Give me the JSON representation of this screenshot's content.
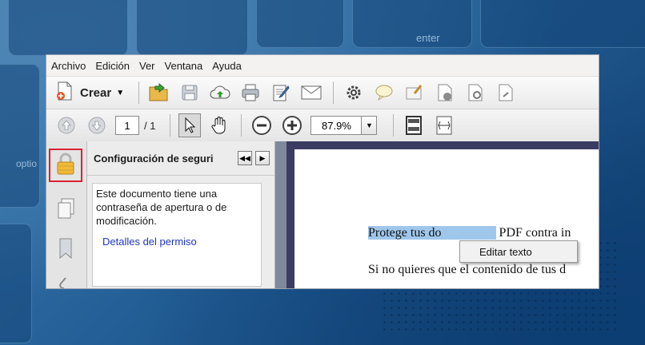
{
  "background": {
    "enter_key": "enter",
    "option_key": "optio"
  },
  "menu": [
    "Archivo",
    "Edición",
    "Ver",
    "Ventana",
    "Ayuda"
  ],
  "toolbar": {
    "crear_label": "Crear",
    "icons": [
      "open-folder-icon",
      "save-icon",
      "cloud-upload-icon",
      "print-icon",
      "edit-document-icon",
      "email-icon",
      "settings-gear-icon",
      "comment-icon",
      "sign-icon",
      "stamp-icon",
      "review-icon",
      "share-icon"
    ]
  },
  "navigation": {
    "current_page": "1",
    "total_pages": "/ 1",
    "zoom": "87.9%"
  },
  "security_panel": {
    "title": "Configuración de seguri",
    "description": "Este documento tiene una contraseña de apertura o de modificación.",
    "permission_link": "Detalles del permiso"
  },
  "document": {
    "line1_highlighted": "Protege tus do",
    "line1_rest": "PDF contra in",
    "line2": "Si no quieres que el contenido de tus d"
  },
  "context_menu": {
    "item": "Editar texto"
  },
  "colors": {
    "highlight": "#d92332",
    "link": "#1f35c2",
    "selection": "#9fc7ec"
  }
}
